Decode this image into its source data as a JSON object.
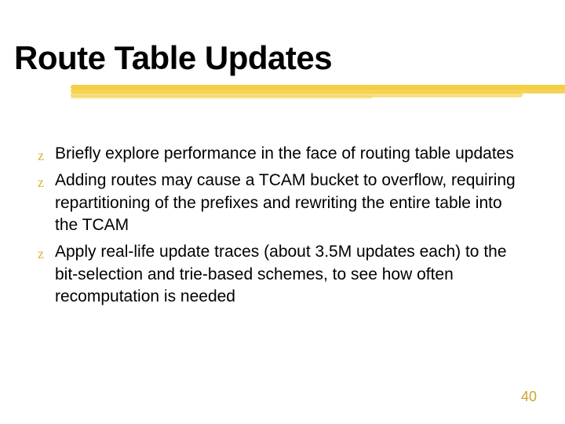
{
  "title": "Route Table Updates",
  "bullets": [
    "Briefly explore performance in the face of routing table updates",
    "Adding routes may cause a TCAM bucket to overflow, requiring repartitioning of the prefixes and rewriting the entire table into the TCAM",
    "Apply real-life update traces (about 3.5M updates each) to the bit-selection and trie-based schemes, to see how often recomputation is needed"
  ],
  "bullet_marker": "z",
  "page_number": "40"
}
